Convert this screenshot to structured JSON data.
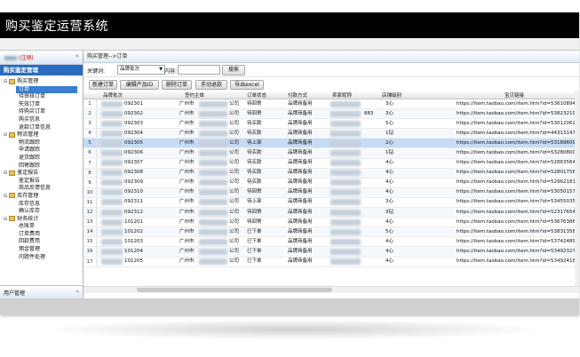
{
  "app": {
    "title": "购买鉴定运营系统"
  },
  "sidebar": {
    "user": "注销",
    "collapse_icon": "«",
    "header": "购买鉴定管理",
    "tree": [
      {
        "label": "购买管理",
        "level": 1,
        "folder": true
      },
      {
        "label": "订单",
        "level": 2,
        "selected": true
      },
      {
        "label": "待审核订单",
        "level": 2
      },
      {
        "label": "失效订单",
        "level": 2
      },
      {
        "label": "待购买订单",
        "level": 2
      },
      {
        "label": "购买信息",
        "level": 2
      },
      {
        "label": "退款订单信息",
        "level": 2
      },
      {
        "label": "物流管理",
        "level": 1,
        "folder": true
      },
      {
        "label": "物流跟踪",
        "level": 2
      },
      {
        "label": "申请跟踪",
        "level": 2
      },
      {
        "label": "退货跟踪",
        "level": 2
      },
      {
        "label": "回寄跟踪",
        "level": 2
      },
      {
        "label": "鉴定报告",
        "level": 1,
        "folder": true
      },
      {
        "label": "鉴定报告",
        "level": 2
      },
      {
        "label": "商品反馈信息",
        "level": 2
      },
      {
        "label": "库存管理",
        "level": 1,
        "folder": true
      },
      {
        "label": "库存信息",
        "level": 2
      },
      {
        "label": "确认库存",
        "level": 2
      },
      {
        "label": "财务统计",
        "level": 1,
        "folder": true
      },
      {
        "label": "总账单",
        "level": 2
      },
      {
        "label": "订单费用",
        "level": 2
      },
      {
        "label": "回款费用",
        "level": 2
      },
      {
        "label": "佣金管理",
        "level": 2
      },
      {
        "label": "问题件处理",
        "level": 2
      }
    ],
    "footer": "用户管理",
    "footer_icon": "»"
  },
  "main": {
    "breadcrumb": "购买管理-->订单",
    "search": {
      "field_label": "关键词:",
      "field_value": "品牌批次",
      "content_label": "内容:",
      "button": "搜索"
    },
    "toolbar": {
      "new": "新建订单",
      "edit": "编辑产品ID",
      "delete": "删除订单",
      "manual": "手动退款",
      "export": "导出excel"
    },
    "columns": [
      "品牌批次",
      "签约主体",
      "订单状态",
      "付款方式",
      "卖家昵称",
      "店铺级别",
      "宝贝链接"
    ],
    "rows": [
      {
        "n": "1",
        "batch": "092301",
        "entity": "广州市",
        "suffix": "公司",
        "status": "待回寄",
        "pay": "品牌商备用",
        "seller": "",
        "level": "3心",
        "link": "https://item.taobao.com/item.htm?id=53610894"
      },
      {
        "n": "2",
        "batch": "092302",
        "entity": "广州市",
        "suffix": "公司",
        "status": "待回寄",
        "pay": "品牌商备用",
        "seller": "883",
        "level": "3心",
        "link": "https://item.taobao.com/item.htm?id=53823219"
      },
      {
        "n": "3",
        "batch": "092303",
        "entity": "广州市",
        "suffix": "公司",
        "status": "待买款",
        "pay": "品牌商备用",
        "seller": "",
        "level": "5心",
        "link": "https://item.taobao.com/item.htm?id=53012062"
      },
      {
        "n": "4",
        "batch": "092304",
        "entity": "广州市",
        "suffix": "公司",
        "status": "待买款",
        "pay": "品牌商备用",
        "seller": "",
        "level": "1钻",
        "link": "https://item.taobao.com/item.htm?id=44313147"
      },
      {
        "n": "5",
        "batch": "092305",
        "entity": "广州市",
        "suffix": "公司",
        "status": "待上架",
        "pay": "品牌商备用",
        "seller": "",
        "level": "2心",
        "link": "https://item.taobao.com/item.htm?id=53189609"
      },
      {
        "n": "6",
        "batch": "092306",
        "entity": "广州市",
        "suffix": "公司",
        "status": "待买款",
        "pay": "品牌商备用",
        "seller": "",
        "level": "1钻",
        "link": "https://item.taobao.com/item.htm?id=53280800"
      },
      {
        "n": "7",
        "batch": "092307",
        "entity": "广州市",
        "suffix": "公司",
        "status": "待买款",
        "pay": "品牌商备用",
        "seller": "",
        "level": "4心",
        "link": "https://item.taobao.com/item.htm?id=52863564"
      },
      {
        "n": "8",
        "batch": "092308",
        "entity": "广州市",
        "suffix": "公司",
        "status": "待买款",
        "pay": "品牌商备用",
        "seller": "",
        "level": "4心",
        "link": "https://item.taobao.com/item.htm?id=52801758"
      },
      {
        "n": "9",
        "batch": "092309",
        "entity": "广州市",
        "suffix": "公司",
        "status": "待买款",
        "pay": "品牌商备用",
        "seller": "",
        "level": "4心",
        "link": "https://item.taobao.com/item.htm?id=52962181"
      },
      {
        "n": "10",
        "batch": "092310",
        "entity": "广州市",
        "suffix": "公司",
        "status": "待回寄",
        "pay": "品牌商备用",
        "seller": "",
        "level": "4心",
        "link": "https://item.taobao.com/item.htm?id=53050157"
      },
      {
        "n": "11",
        "batch": "092311",
        "entity": "广州市",
        "suffix": "公司",
        "status": "待上架",
        "pay": "品牌商备用",
        "seller": "",
        "level": "3心",
        "link": "https://item.taobao.com/item.htm?id=53455035"
      },
      {
        "n": "12",
        "batch": "092312",
        "entity": "广州市",
        "suffix": "公司",
        "status": "待回寄",
        "pay": "品牌商备用",
        "seller": "",
        "level": "3钻",
        "link": "https://item.taobao.com/item.htm?id=52317654"
      },
      {
        "n": "13",
        "batch": "101201",
        "entity": "广州市",
        "suffix": "公司",
        "status": "待回寄",
        "pay": "品牌商备用",
        "seller": "",
        "level": "4心",
        "link": "https://item.taobao.com/item.htm?id=53676386"
      },
      {
        "n": "14",
        "batch": "101202",
        "entity": "广州市",
        "suffix": "公司",
        "status": "已下单",
        "pay": "品牌商备用",
        "seller": "",
        "level": "5心",
        "link": "https://item.taobao.com/item.htm?id=53831358"
      },
      {
        "n": "15",
        "batch": "101203",
        "entity": "广州市",
        "suffix": "公司",
        "status": "已下单",
        "pay": "品牌商备用",
        "seller": "",
        "level": "4心",
        "link": "https://item.taobao.com/item.htm?id=53742489"
      },
      {
        "n": "16",
        "batch": "101204",
        "entity": "广州市",
        "suffix": "公司",
        "status": "已下单",
        "pay": "品牌商备用",
        "seller": "",
        "level": "4心",
        "link": "https://item.taobao.com/item.htm?id=53492327"
      },
      {
        "n": "17",
        "batch": "101205",
        "entity": "广州市",
        "suffix": "公司",
        "status": "已下单",
        "pay": "品牌商备用",
        "seller": "",
        "level": "4心",
        "link": "https://item.taobao.com/item.htm?id=53492418"
      }
    ]
  }
}
